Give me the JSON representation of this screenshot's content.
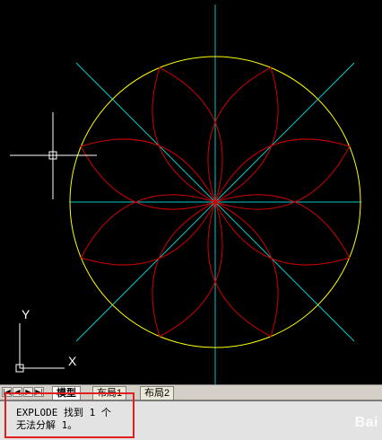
{
  "canvas": {
    "background": "#000000",
    "colors": {
      "circle": "#ffff00",
      "axes": "#00c8c8",
      "petals": "#cc0000",
      "cursor": "#ffffff",
      "ucs": "#ffffff"
    },
    "ucs_labels": {
      "x": "X",
      "y": "Y"
    }
  },
  "tabs": {
    "nav_buttons": [
      "first-icon",
      "prev-icon",
      "next-icon",
      "last-icon"
    ],
    "items": [
      {
        "label": "模型",
        "active": true
      },
      {
        "label": "布局1",
        "active": false
      },
      {
        "label": "布局2",
        "active": false
      }
    ]
  },
  "command": {
    "line1": "EXPLODE 找到 1 个",
    "line2": "无法分解 1。",
    "highlight_color": "#e02020"
  },
  "watermark": {
    "text": "Bai"
  }
}
